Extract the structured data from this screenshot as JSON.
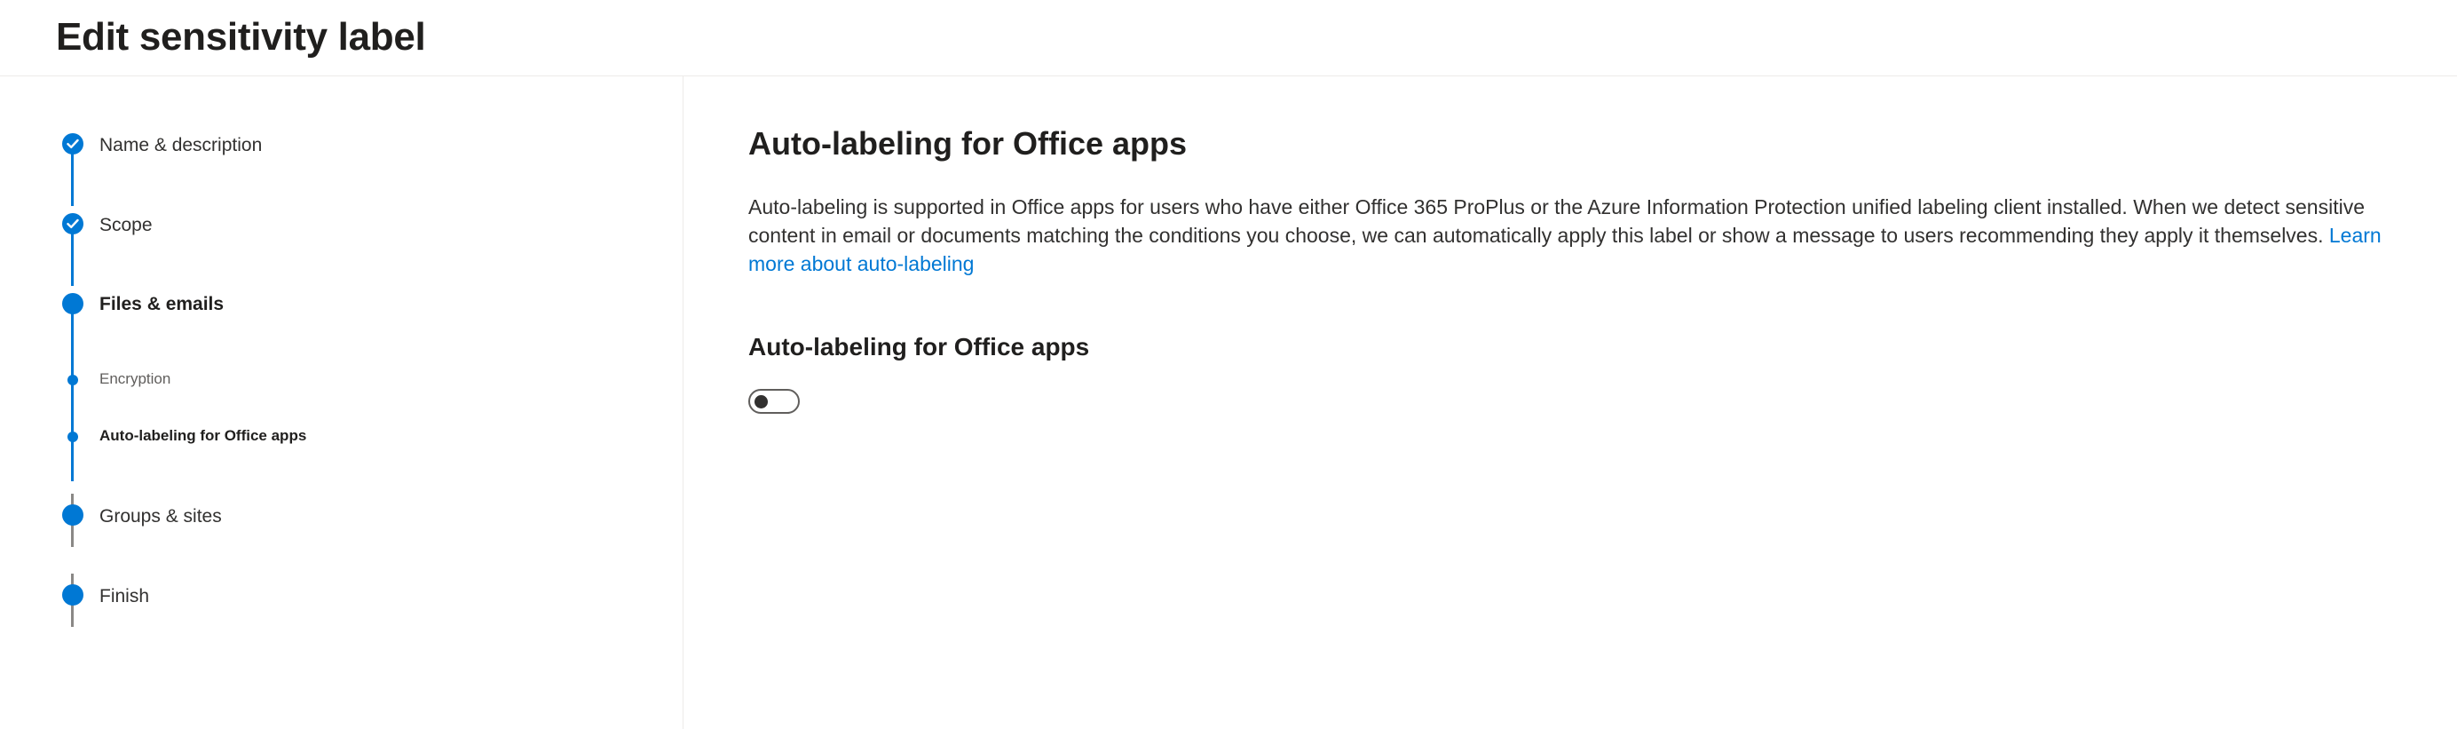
{
  "header": {
    "title": "Edit sensitivity label"
  },
  "stepper": {
    "steps": [
      {
        "label": "Name & description",
        "status": "completed",
        "icon": "checkmark-icon"
      },
      {
        "label": "Scope",
        "status": "completed",
        "icon": "checkmark-icon"
      },
      {
        "label": "Files & emails",
        "status": "current"
      },
      {
        "label": "Encryption",
        "status": "completed-substep"
      },
      {
        "label": "Auto-labeling for Office apps",
        "status": "current-substep"
      },
      {
        "label": "Groups & sites",
        "status": "not-started"
      },
      {
        "label": "Finish",
        "status": "not-started"
      }
    ]
  },
  "main": {
    "heading": "Auto-labeling for Office apps",
    "description": "Auto-labeling is supported in Office apps for users who have either Office 365 ProPlus or the Azure Information Protection unified labeling client installed. When we detect sensitive content in email or documents matching the conditions you choose, we can automatically apply this label or show a message to users recommending they apply it themselves.",
    "learn_more_link": "Learn more about auto-labeling",
    "section_heading": "Auto-labeling for Office apps",
    "toggle_state": "off"
  },
  "colors": {
    "accent": "#0078d4",
    "text": "#323130",
    "inactive_line": "#8a8886"
  }
}
